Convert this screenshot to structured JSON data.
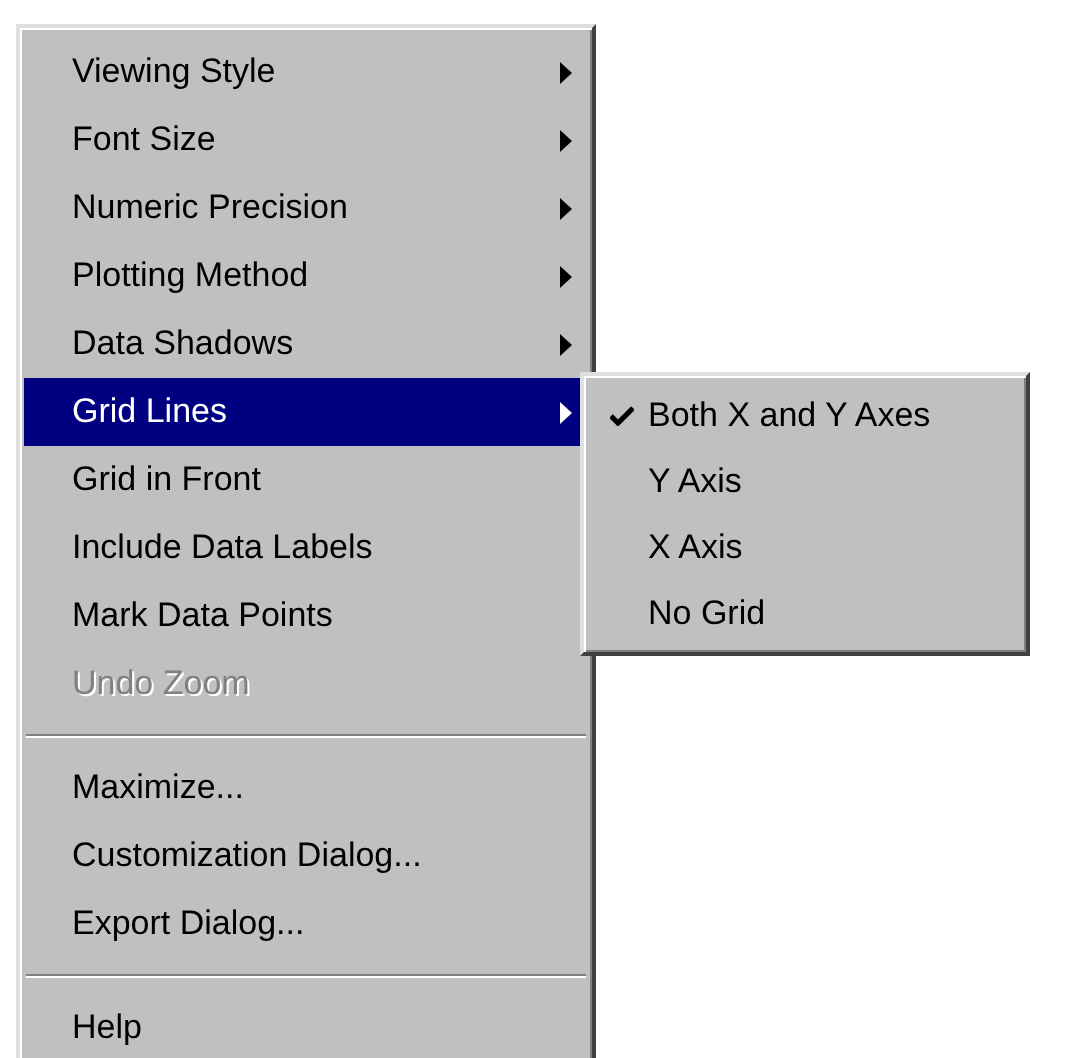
{
  "menu": {
    "items": [
      {
        "kind": "submenu",
        "label": "Viewing Style",
        "selected": false,
        "disabled": false
      },
      {
        "kind": "submenu",
        "label": "Font Size",
        "selected": false,
        "disabled": false
      },
      {
        "kind": "submenu",
        "label": "Numeric Precision",
        "selected": false,
        "disabled": false
      },
      {
        "kind": "submenu",
        "label": "Plotting Method",
        "selected": false,
        "disabled": false
      },
      {
        "kind": "submenu",
        "label": "Data Shadows",
        "selected": false,
        "disabled": false
      },
      {
        "kind": "submenu",
        "label": "Grid Lines",
        "selected": true,
        "disabled": false
      },
      {
        "kind": "command",
        "label": "Grid in Front",
        "selected": false,
        "disabled": false
      },
      {
        "kind": "command",
        "label": "Include Data Labels",
        "selected": false,
        "disabled": false
      },
      {
        "kind": "command",
        "label": "Mark Data Points",
        "selected": false,
        "disabled": false
      },
      {
        "kind": "command",
        "label": "Undo Zoom",
        "selected": false,
        "disabled": true
      },
      {
        "kind": "separator"
      },
      {
        "kind": "command",
        "label": "Maximize...",
        "selected": false,
        "disabled": false
      },
      {
        "kind": "command",
        "label": "Customization Dialog...",
        "selected": false,
        "disabled": false
      },
      {
        "kind": "command",
        "label": "Export Dialog...",
        "selected": false,
        "disabled": false
      },
      {
        "kind": "separator"
      },
      {
        "kind": "command",
        "label": "Help",
        "selected": false,
        "disabled": false
      }
    ]
  },
  "submenu": {
    "items": [
      {
        "label": "Both X and Y Axes",
        "checked": true
      },
      {
        "label": "Y Axis",
        "checked": false
      },
      {
        "label": "X Axis",
        "checked": false
      },
      {
        "label": "No Grid",
        "checked": false
      }
    ]
  }
}
